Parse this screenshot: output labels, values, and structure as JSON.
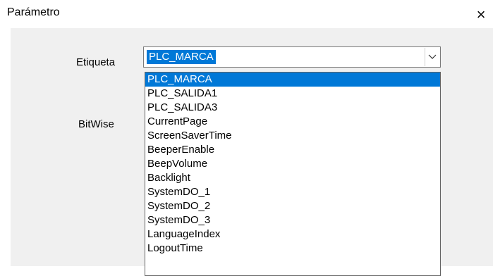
{
  "dialog": {
    "title": "Parámetro",
    "close_label": "×"
  },
  "form": {
    "etiqueta_label": "Etiqueta",
    "bitwise_label": "BitWise"
  },
  "combo": {
    "value": "PLC_MARCA",
    "chevron_icon": "chevron-down-icon"
  },
  "dropdown": {
    "selected_index": 0,
    "items": [
      "PLC_MARCA",
      "PLC_SALIDA1",
      "PLC_SALIDA3",
      "CurrentPage",
      "ScreenSaverTime",
      "BeeperEnable",
      "BeepVolume",
      "Backlight",
      "SystemDO_1",
      "SystemDO_2",
      "SystemDO_3",
      "LanguageIndex",
      "LogoutTime"
    ]
  },
  "colors": {
    "selection": "#0078d7",
    "client_background": "#f0f0f0"
  }
}
